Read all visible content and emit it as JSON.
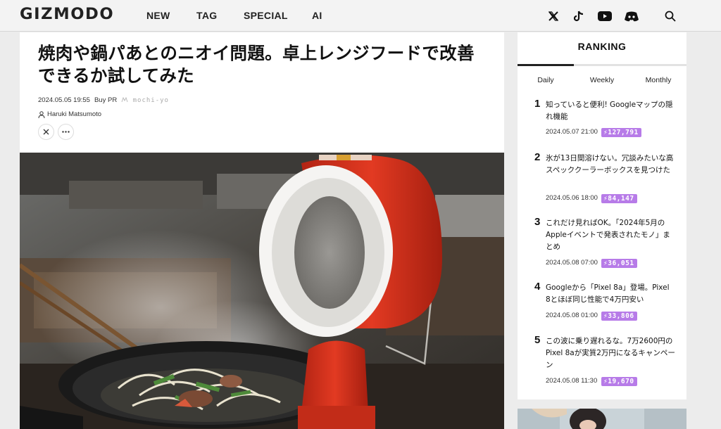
{
  "header": {
    "logo": "GIZMODO",
    "nav": [
      "NEW",
      "TAG",
      "SPECIAL",
      "AI"
    ],
    "icons": [
      "x-icon",
      "tiktok-icon",
      "youtube-icon",
      "discord-icon",
      "search-icon"
    ]
  },
  "article": {
    "title": "焼肉や鍋パあとのニオイ問題。卓上レンジフードで改善できるか試してみた",
    "date": "2024.05.05 19:55",
    "label": "Buy PR",
    "sponsor": "mochi-yo",
    "author": "Haruki Matsumoto",
    "share": [
      "x-icon",
      "more-icon"
    ]
  },
  "ranking": {
    "title": "RANKING",
    "tabs": [
      "Daily",
      "Weekly",
      "Monthly"
    ],
    "active_tab": "Daily",
    "items": [
      {
        "rank": "1",
        "title": "知っていると便利! Googleマップの隠れ機能",
        "date": "2024.05.07 21:00",
        "views": "127,791"
      },
      {
        "rank": "2",
        "title": "氷が13日間溶けない。冗談みたいな高スペッククーラーボックスを見つけた",
        "date": "2024.05.06 18:00",
        "views": "84,147"
      },
      {
        "rank": "3",
        "title": "これだけ見ればOK。「2024年5月のAppleイベントで発表されたモノ」まとめ",
        "date": "2024.05.08 07:00",
        "views": "36,051"
      },
      {
        "rank": "4",
        "title": "Googleから「Pixel 8a」登場。Pixel 8とほぼ同じ性能で4万円安い",
        "date": "2024.05.08 01:00",
        "views": "33,806"
      },
      {
        "rank": "5",
        "title": "この波に乗り遅れるな。7万2600円のPixel 8aが実質2万円になるキャンペーン",
        "date": "2024.05.08 11:30",
        "views": "19,670"
      }
    ]
  },
  "colors": {
    "views_badge": "#b77be8",
    "fan_red": "#d8321e",
    "header_bg": "#f3f3f3"
  }
}
